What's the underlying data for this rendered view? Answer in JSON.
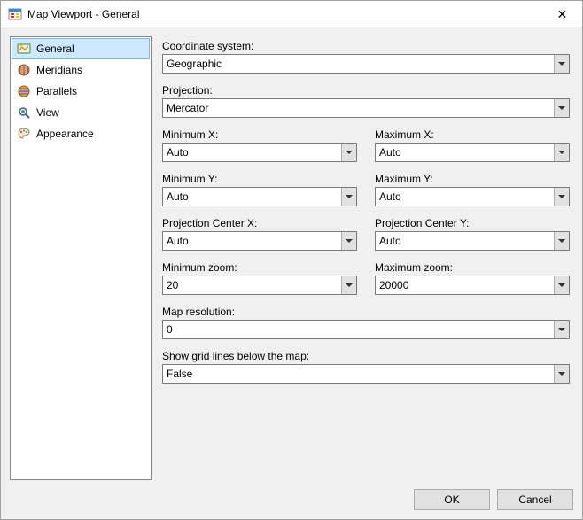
{
  "window": {
    "title": "Map Viewport - General"
  },
  "sidebar": {
    "items": [
      {
        "label": "General",
        "icon": "general",
        "selected": true
      },
      {
        "label": "Meridians",
        "icon": "meridians",
        "selected": false
      },
      {
        "label": "Parallels",
        "icon": "parallels",
        "selected": false
      },
      {
        "label": "View",
        "icon": "view",
        "selected": false
      },
      {
        "label": "Appearance",
        "icon": "appearance",
        "selected": false
      }
    ]
  },
  "form": {
    "coord_label": "Coordinate system:",
    "coord_value": "Geographic",
    "proj_label": "Projection:",
    "proj_value": "Mercator",
    "minx_label": "Minimum X:",
    "minx_value": "Auto",
    "maxx_label": "Maximum X:",
    "maxx_value": "Auto",
    "miny_label": "Minimum Y:",
    "miny_value": "Auto",
    "maxy_label": "Maximum Y:",
    "maxy_value": "Auto",
    "pcx_label": "Projection Center X:",
    "pcx_value": "Auto",
    "pcy_label": "Projection Center Y:",
    "pcy_value": "Auto",
    "minzoom_label": "Minimum zoom:",
    "minzoom_value": "20",
    "maxzoom_label": "Maximum zoom:",
    "maxzoom_value": "20000",
    "res_label": "Map resolution:",
    "res_value": "0",
    "grid_label": "Show grid lines below the map:",
    "grid_value": "False"
  },
  "buttons": {
    "ok": "OK",
    "cancel": "Cancel"
  }
}
